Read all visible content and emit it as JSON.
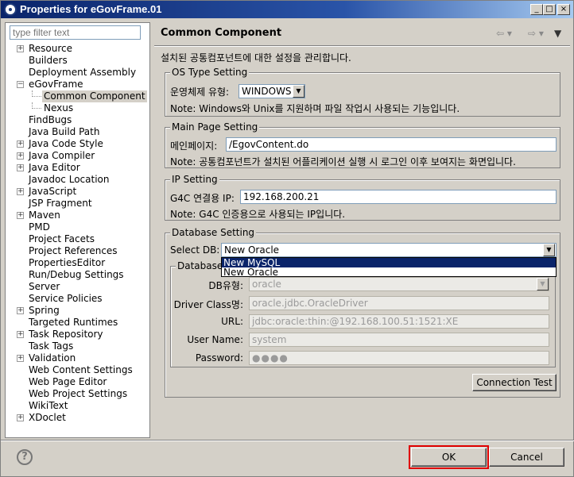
{
  "window": {
    "title": "Properties for eGovFrame.01"
  },
  "filter": {
    "placeholder": "type filter text"
  },
  "tree": [
    {
      "label": "Resource",
      "expander": "+",
      "child": false
    },
    {
      "label": "Builders",
      "expander": "",
      "child": false
    },
    {
      "label": "Deployment Assembly",
      "expander": "",
      "child": false
    },
    {
      "label": "eGovFrame",
      "expander": "−",
      "child": false
    },
    {
      "label": "Common Component",
      "expander": "",
      "child": true,
      "selected": true
    },
    {
      "label": "Nexus",
      "expander": "",
      "child": true
    },
    {
      "label": "FindBugs",
      "expander": "",
      "child": false
    },
    {
      "label": "Java Build Path",
      "expander": "",
      "child": false
    },
    {
      "label": "Java Code Style",
      "expander": "+",
      "child": false
    },
    {
      "label": "Java Compiler",
      "expander": "+",
      "child": false
    },
    {
      "label": "Java Editor",
      "expander": "+",
      "child": false
    },
    {
      "label": "Javadoc Location",
      "expander": "",
      "child": false
    },
    {
      "label": "JavaScript",
      "expander": "+",
      "child": false
    },
    {
      "label": "JSP Fragment",
      "expander": "",
      "child": false
    },
    {
      "label": "Maven",
      "expander": "+",
      "child": false
    },
    {
      "label": "PMD",
      "expander": "",
      "child": false
    },
    {
      "label": "Project Facets",
      "expander": "",
      "child": false
    },
    {
      "label": "Project References",
      "expander": "",
      "child": false
    },
    {
      "label": "PropertiesEditor",
      "expander": "",
      "child": false
    },
    {
      "label": "Run/Debug Settings",
      "expander": "",
      "child": false
    },
    {
      "label": "Server",
      "expander": "",
      "child": false
    },
    {
      "label": "Service Policies",
      "expander": "",
      "child": false
    },
    {
      "label": "Spring",
      "expander": "+",
      "child": false
    },
    {
      "label": "Targeted Runtimes",
      "expander": "",
      "child": false
    },
    {
      "label": "Task Repository",
      "expander": "+",
      "child": false
    },
    {
      "label": "Task Tags",
      "expander": "",
      "child": false
    },
    {
      "label": "Validation",
      "expander": "+",
      "child": false
    },
    {
      "label": "Web Content Settings",
      "expander": "",
      "child": false
    },
    {
      "label": "Web Page Editor",
      "expander": "",
      "child": false
    },
    {
      "label": "Web Project Settings",
      "expander": "",
      "child": false
    },
    {
      "label": "WikiText",
      "expander": "",
      "child": false
    },
    {
      "label": "XDoclet",
      "expander": "+",
      "child": false
    }
  ],
  "page": {
    "title": "Common Component",
    "description": "설치된 공통컴포넌트에 대한 설정을 관리합니다."
  },
  "os": {
    "title": "OS Type Setting",
    "label": "운영체제 유형:",
    "value": "WINDOWS",
    "note": "Note: Windows와 Unix를 지원하며 파일 작업시 사용되는 기능입니다."
  },
  "main_page": {
    "title": "Main Page Setting",
    "label": "메인페이지:",
    "value": "/EgovContent.do",
    "note": "Note: 공통컴포넌트가 설치된 어플리케이션 실행 시 로그인 이후  보여지는 화면입니다."
  },
  "ip": {
    "title": "IP Setting",
    "label": "G4C 연결용 IP:",
    "value": "192.168.200.21",
    "note": "Note: G4C 인증용으로 사용되는 IP입니다."
  },
  "db": {
    "title": "Database Setting",
    "select_label": "Select DB:",
    "select_value": "New Oracle",
    "options": [
      "New MySQL",
      "New Oracle"
    ],
    "inner_title": "Database",
    "type_label": "DB유형:",
    "type_value": "oracle",
    "driver_label": "Driver Class명:",
    "driver_value": "oracle.jdbc.OracleDriver",
    "url_label": "URL:",
    "url_value": "jdbc:oracle:thin:@192.168.100.51:1521:XE",
    "user_label": "User Name:",
    "user_value": "system",
    "password_label": "Password:",
    "password_value": "●●●●",
    "test_button": "Connection Test"
  },
  "buttons": {
    "ok": "OK",
    "cancel": "Cancel",
    "help": "?"
  },
  "colors": {
    "highlight": "#0a246a",
    "ok_frame": "#e00000"
  }
}
